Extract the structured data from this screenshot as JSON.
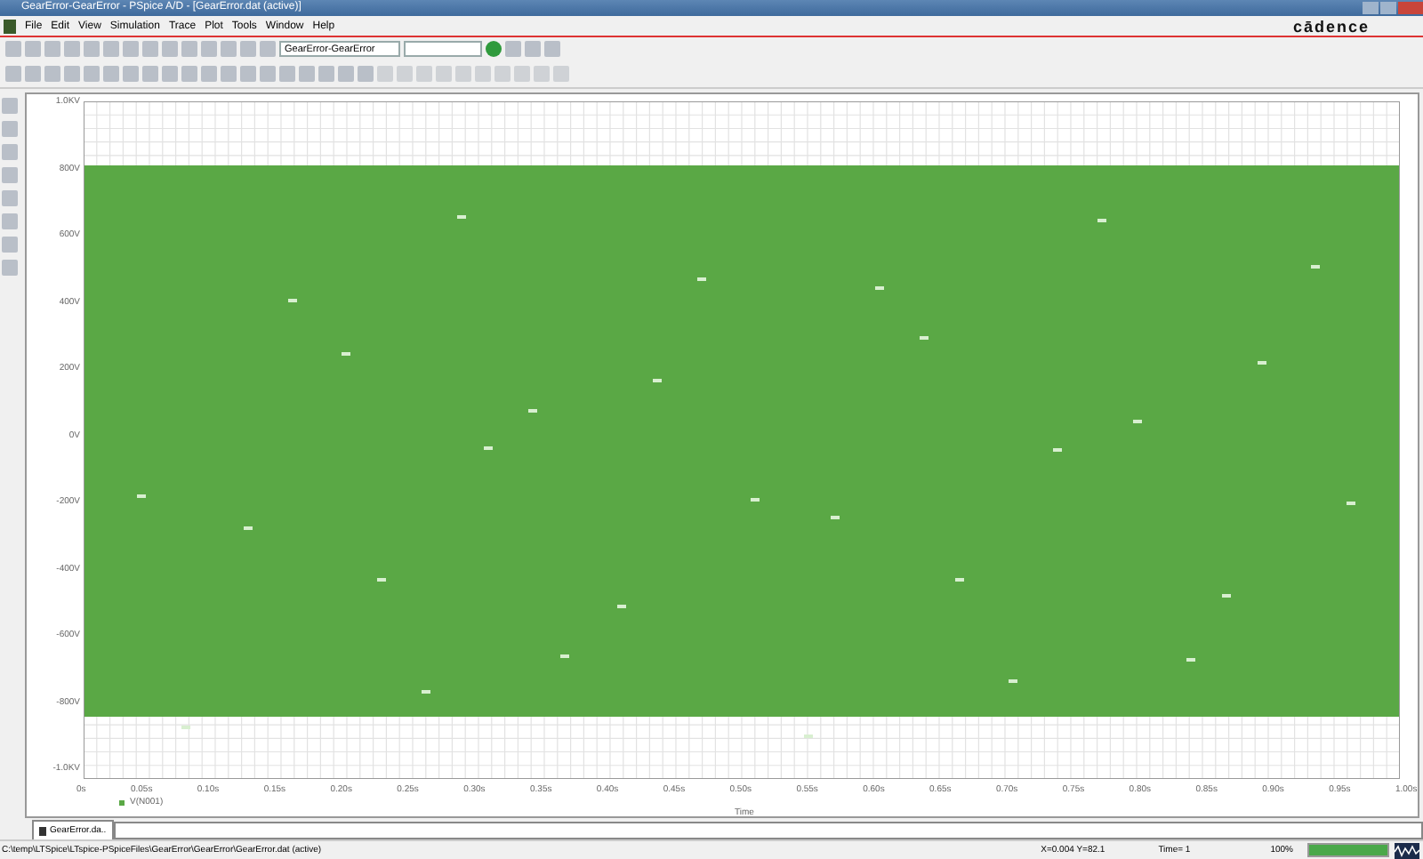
{
  "window": {
    "title": "GearError-GearError - PSpice A/D - [GearError.dat (active)]"
  },
  "menu": [
    "File",
    "Edit",
    "View",
    "Simulation",
    "Trace",
    "Plot",
    "Tools",
    "Window",
    "Help"
  ],
  "brand": "cādence",
  "toolbar": {
    "profile_field": "GearError-GearError"
  },
  "plot": {
    "y_ticks": [
      "1.0KV",
      "800V",
      "600V",
      "400V",
      "200V",
      "0V",
      "-200V",
      "-400V",
      "-600V",
      "-800V",
      "-1.0KV"
    ],
    "x_ticks": [
      "0s",
      "0.05s",
      "0.10s",
      "0.15s",
      "0.20s",
      "0.25s",
      "0.30s",
      "0.35s",
      "0.40s",
      "0.45s",
      "0.50s",
      "0.55s",
      "0.60s",
      "0.65s",
      "0.70s",
      "0.75s",
      "0.80s",
      "0.85s",
      "0.90s",
      "0.95s",
      "1.00s"
    ],
    "legend": "V(N001)",
    "x_label": "Time"
  },
  "tabs": [
    {
      "label": "GearError.da..",
      "selected": true
    }
  ],
  "status_bar": {
    "path": "C:\\temp\\LTSpice\\LTspice-PSpiceFiles\\GearError\\GearError\\GearError.dat (active)",
    "cursor": "X=0.004  Y=82.1",
    "time": "Time= 1",
    "percent": "100%",
    "level": 1
  }
}
